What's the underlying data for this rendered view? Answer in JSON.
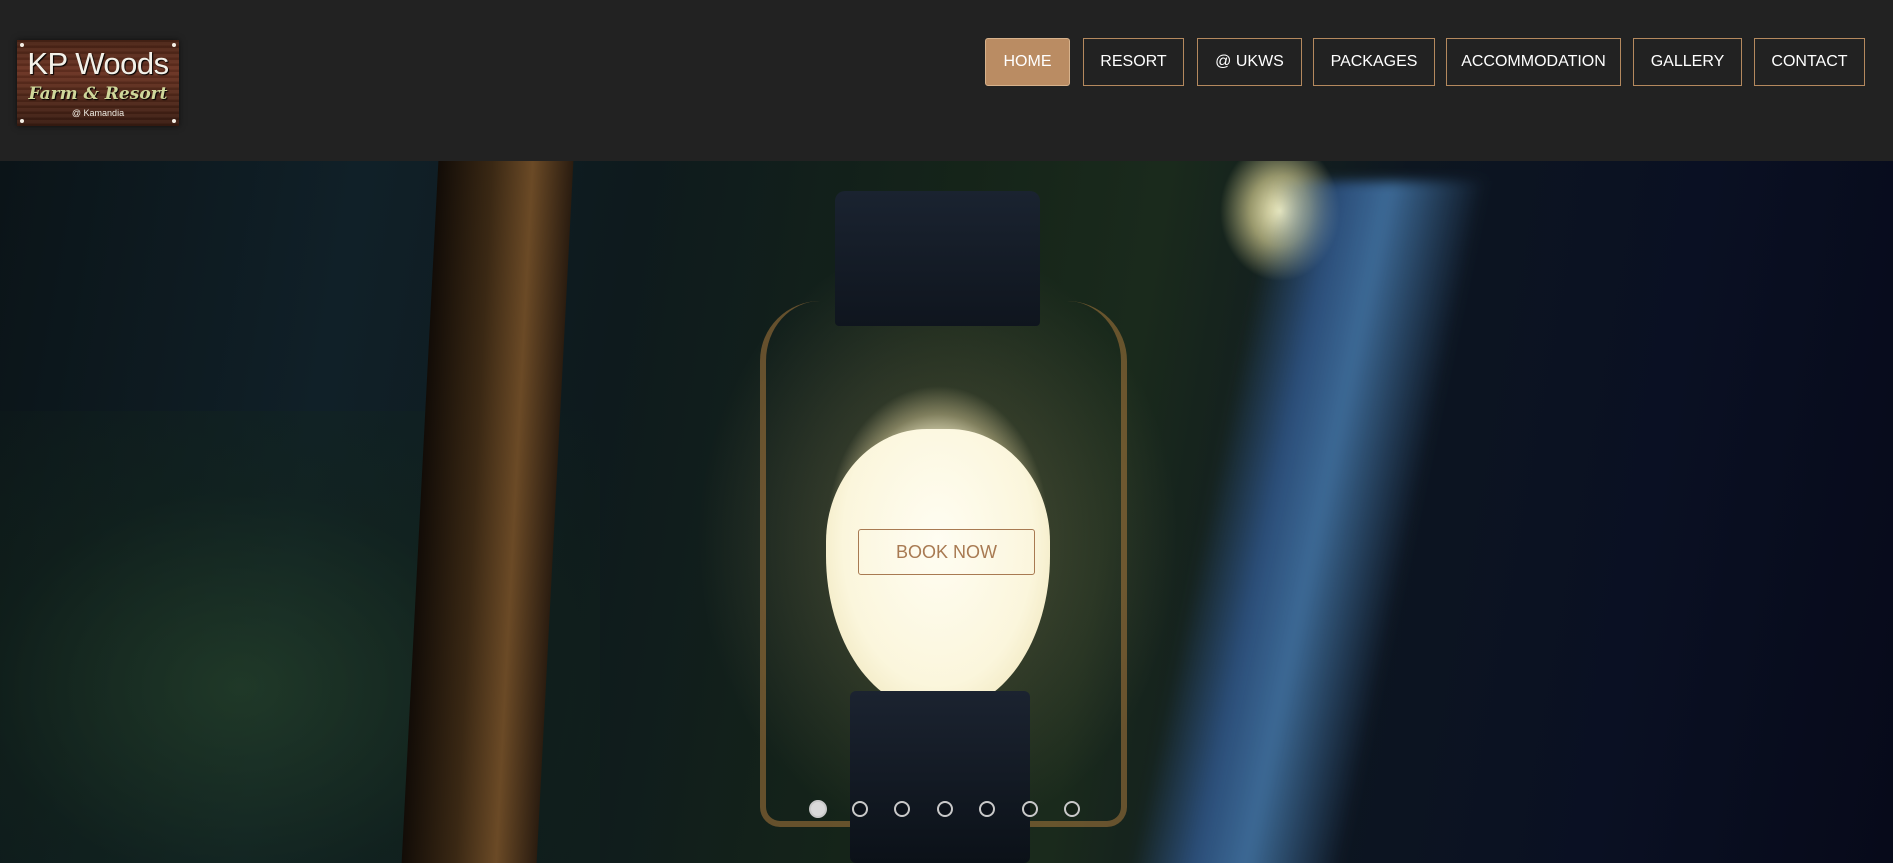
{
  "logo": {
    "line1": "KP Woods",
    "line2": "Farm & Resort",
    "line3": "@ Kamandia"
  },
  "nav": {
    "items": [
      {
        "label": "HOME",
        "active": true
      },
      {
        "label": "RESORT",
        "active": false
      },
      {
        "label": "@ UKWS",
        "active": false
      },
      {
        "label": "PACKAGES",
        "active": false
      },
      {
        "label": "ACCOMMODATION",
        "active": false
      },
      {
        "label": "GALLERY",
        "active": false
      },
      {
        "label": "CONTACT",
        "active": false
      }
    ]
  },
  "hero": {
    "cta_label": "BOOK NOW",
    "slide_count": 7,
    "active_slide": 1
  },
  "colors": {
    "header_bg": "#222222",
    "accent": "#ba8c63",
    "nav_border": "#b4895e",
    "cta_text": "#a87a52"
  }
}
